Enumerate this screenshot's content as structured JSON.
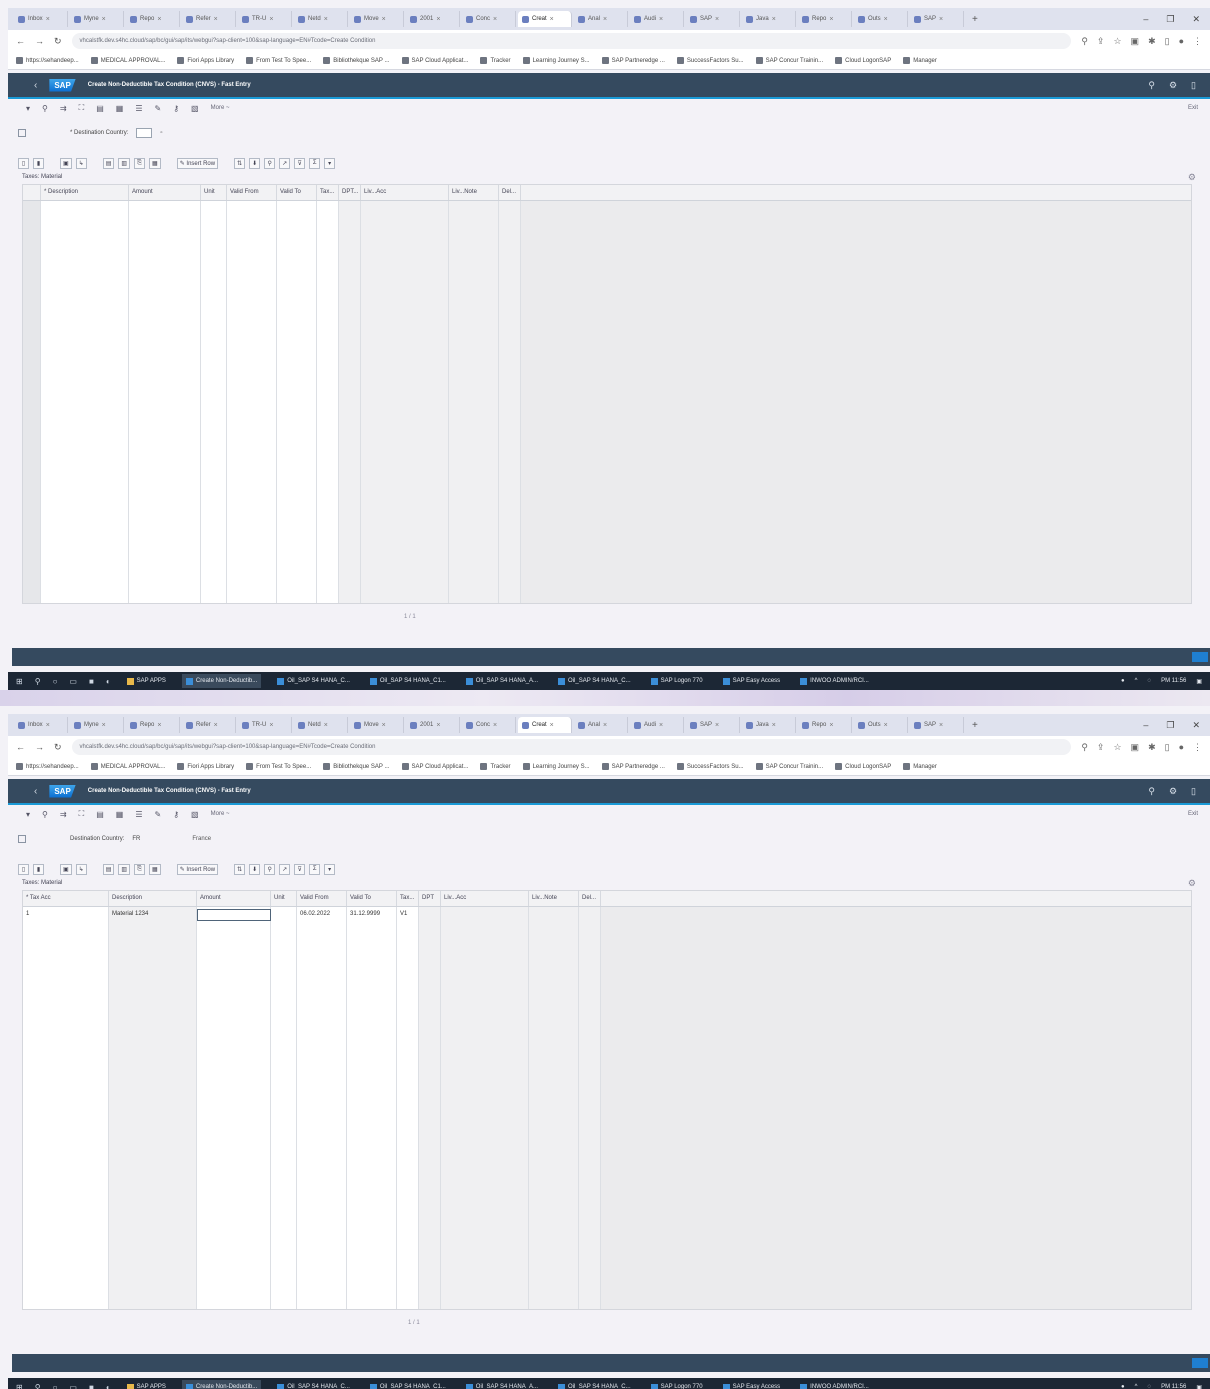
{
  "browser": {
    "tabs": [
      {
        "label": "Inbox",
        "active": false
      },
      {
        "label": "Myne",
        "active": false
      },
      {
        "label": "Repo",
        "active": false
      },
      {
        "label": "Refer",
        "active": false
      },
      {
        "label": "TR-U",
        "active": false
      },
      {
        "label": "Netd",
        "active": false
      },
      {
        "label": "Move",
        "active": false
      },
      {
        "label": "2001",
        "active": false
      },
      {
        "label": "Conc",
        "active": false
      },
      {
        "label": "Creat",
        "active": true
      },
      {
        "label": "Anal",
        "active": false
      },
      {
        "label": "Audi",
        "active": false
      },
      {
        "label": "SAP",
        "active": false
      },
      {
        "label": "Java",
        "active": false
      },
      {
        "label": "Repo",
        "active": false
      },
      {
        "label": "Outs",
        "active": false
      },
      {
        "label": "SAP",
        "active": false
      }
    ],
    "url": "vhcalstfk.dev.s4hc.cloud/sap/bc/gui/sap/its/webgui?sap-client=100&sap-language=EN#Tcode=Create Condition",
    "bookmarks": [
      "https://sehandeep...",
      "MEDICAL APPROVAL...",
      "Fiori Apps Library",
      "From Test To Spee...",
      "Bibliothekque SAP ...",
      "SAP Cloud Applicat...",
      "Tracker",
      "Learning Journey S...",
      "SAP Partneredge ...",
      "SuccessFactors Su...",
      "SAP Concur Trainin...",
      "Cloud LogonSAP",
      "Manager"
    ]
  },
  "shell": {
    "back_symbol": "‹",
    "logo": "SAP",
    "title": "Create Non-Deductible Tax Condition (CNVS) - Fast Entry"
  },
  "toolbar": {
    "more_label": "More ~",
    "exit_label": "Exit"
  },
  "screens": [
    {
      "selection": {
        "label": "* Destination Country:",
        "value": "",
        "status": ""
      },
      "grid_caption": "Taxes: Material",
      "columns": [
        "* Description",
        "Amount",
        "Unit",
        "Valid From",
        "Valid To",
        "Tax...",
        "DPT...",
        "Liv...Acc",
        "Liv...Note",
        "Del..."
      ],
      "rows": [],
      "pager": "1 / 1"
    },
    {
      "selection": {
        "label": "Destination Country:",
        "value": "FR",
        "status": "France"
      },
      "grid_caption": "Taxes: Material",
      "columns": [
        "* Tax Acc",
        "Description",
        "Amount",
        "Unit",
        "Valid From",
        "Valid To",
        "Tax...",
        "DPT",
        "Liv...Acc",
        "Liv...Note",
        "Del..."
      ],
      "rows": [
        [
          "1",
          "Material 1234",
          "",
          "",
          "06.02.2022",
          "31.12.9999",
          "V1",
          "",
          "",
          "",
          ""
        ]
      ],
      "pager": "1 / 1"
    }
  ],
  "taskbar": {
    "search_label": "SAP APPS",
    "apps": [
      "Create Non-Deductib...",
      "Oil_SAP S4 HANA_C...",
      "Oil_SAP S4 HANA_C1...",
      "Oil_SAP S4 HANA_A...",
      "Oil_SAP S4 HANA_C...",
      "SAP Logon 770",
      "SAP Easy Access",
      "INWOO ADMIN/RCI..."
    ],
    "clock": "PM 11:56"
  }
}
